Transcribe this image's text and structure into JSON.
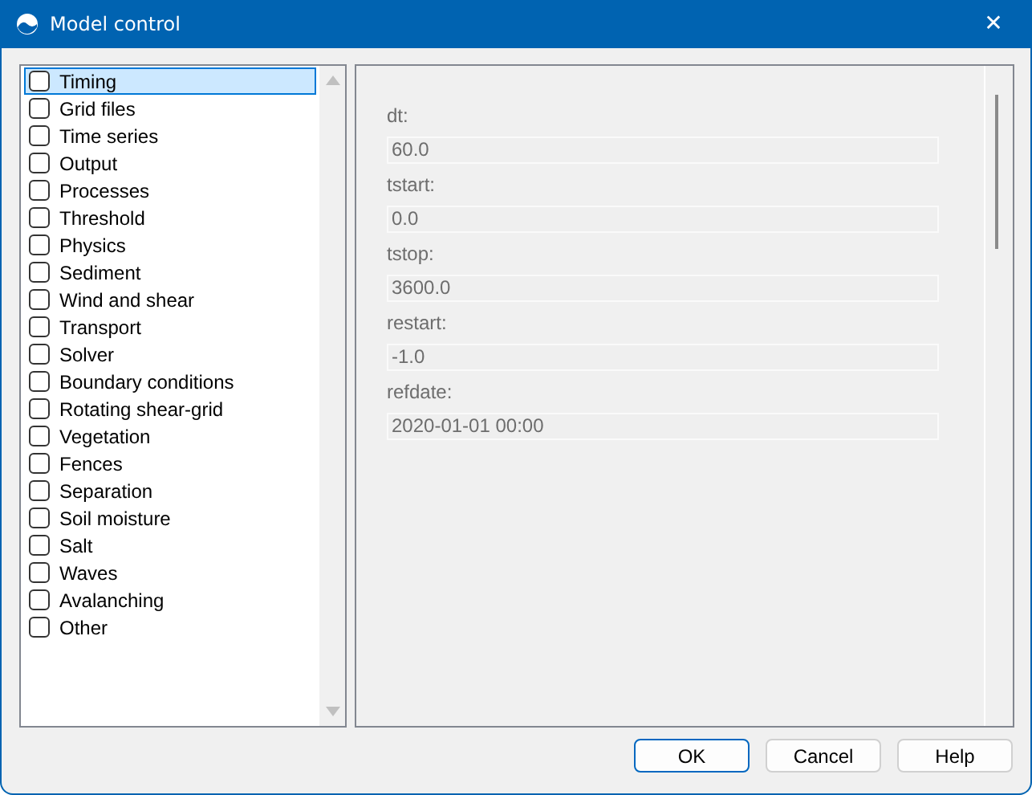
{
  "window": {
    "title": "Model control",
    "close": "✕"
  },
  "sidebar": {
    "items": [
      {
        "label": "Timing",
        "selected": true,
        "checked": false
      },
      {
        "label": "Grid files",
        "selected": false,
        "checked": false
      },
      {
        "label": "Time series",
        "selected": false,
        "checked": false
      },
      {
        "label": "Output",
        "selected": false,
        "checked": false
      },
      {
        "label": "Processes",
        "selected": false,
        "checked": false
      },
      {
        "label": "Threshold",
        "selected": false,
        "checked": false
      },
      {
        "label": "Physics",
        "selected": false,
        "checked": false
      },
      {
        "label": "Sediment",
        "selected": false,
        "checked": false
      },
      {
        "label": "Wind and shear",
        "selected": false,
        "checked": false
      },
      {
        "label": "Transport",
        "selected": false,
        "checked": false
      },
      {
        "label": "Solver",
        "selected": false,
        "checked": false
      },
      {
        "label": "Boundary conditions",
        "selected": false,
        "checked": false
      },
      {
        "label": "Rotating shear-grid",
        "selected": false,
        "checked": false
      },
      {
        "label": "Vegetation",
        "selected": false,
        "checked": false
      },
      {
        "label": "Fences",
        "selected": false,
        "checked": false
      },
      {
        "label": "Separation",
        "selected": false,
        "checked": false
      },
      {
        "label": "Soil moisture",
        "selected": false,
        "checked": false
      },
      {
        "label": "Salt",
        "selected": false,
        "checked": false
      },
      {
        "label": "Waves",
        "selected": false,
        "checked": false
      },
      {
        "label": "Avalanching",
        "selected": false,
        "checked": false
      },
      {
        "label": "Other",
        "selected": false,
        "checked": false
      }
    ]
  },
  "form": {
    "fields": [
      {
        "label": "dt:",
        "value": "60.0",
        "disabled": true
      },
      {
        "label": "tstart:",
        "value": "0.0",
        "disabled": true
      },
      {
        "label": "tstop:",
        "value": "3600.0",
        "disabled": true
      },
      {
        "label": "restart:",
        "value": "-1.0",
        "disabled": true
      },
      {
        "label": "refdate:",
        "value": "2020-01-01 00:00",
        "disabled": true
      }
    ]
  },
  "buttons": [
    {
      "label": "OK",
      "default": true
    },
    {
      "label": "Cancel",
      "default": false
    },
    {
      "label": "Help",
      "default": false
    }
  ]
}
